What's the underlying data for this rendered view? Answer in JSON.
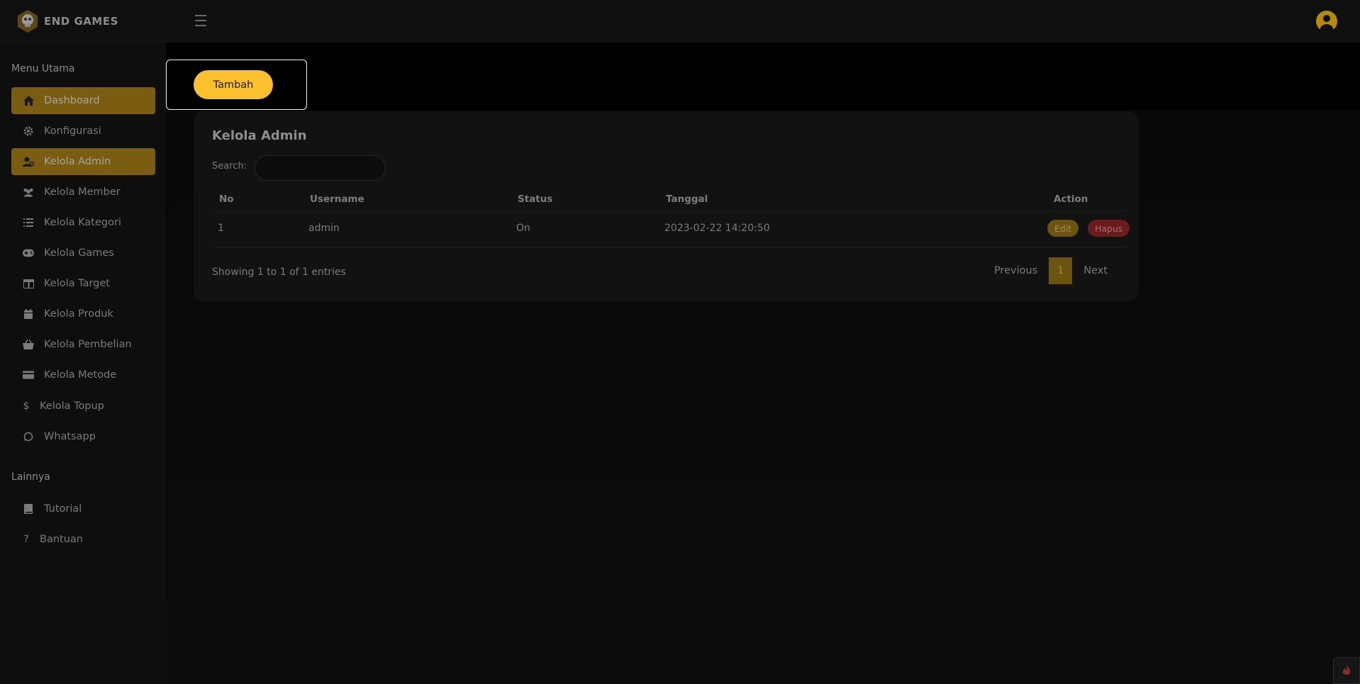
{
  "brand": {
    "name": "END GAMES"
  },
  "sidebar": {
    "section_main": "Menu Utama",
    "items": [
      {
        "label": "Dashboard",
        "icon": "home-icon",
        "active": true
      },
      {
        "label": "Konfigurasi",
        "icon": "gear-icon",
        "active": false
      },
      {
        "label": "Kelola Admin",
        "icon": "user-cog-icon",
        "active": true
      },
      {
        "label": "Kelola Member",
        "icon": "users-icon",
        "active": false
      },
      {
        "label": "Kelola Kategori",
        "icon": "list-icon",
        "active": false
      },
      {
        "label": "Kelola Games",
        "icon": "gamepad-icon",
        "active": false
      },
      {
        "label": "Kelola Target",
        "icon": "table-icon",
        "active": false
      },
      {
        "label": "Kelola Produk",
        "icon": "calendar-icon",
        "active": false
      },
      {
        "label": "Kelola Pembelian",
        "icon": "basket-icon",
        "active": false
      },
      {
        "label": "Kelola Metode",
        "icon": "credit-card-icon",
        "active": false
      },
      {
        "label": "Kelola Topup",
        "icon": "dollar-icon",
        "active": false
      },
      {
        "label": "Whatsapp",
        "icon": "whatsapp-icon",
        "active": false
      }
    ],
    "section_other": "Lainnya",
    "other_items": [
      {
        "label": "Tutorial",
        "icon": "book-icon"
      },
      {
        "label": "Bantuan",
        "icon": "question-icon"
      }
    ]
  },
  "main": {
    "add_button": "Tambah",
    "card_title": "Kelola Admin",
    "search_label": "Search:",
    "search_value": "",
    "columns": [
      "No",
      "Username",
      "Status",
      "Tanggal",
      "Action"
    ],
    "rows": [
      {
        "no": "1",
        "username": "admin",
        "status": "On",
        "tanggal": "2023-02-22 14:20:50"
      }
    ],
    "edit_label": "Edit",
    "delete_label": "Hapus",
    "info": "Showing 1 to 1 of 1 entries",
    "pager": {
      "prev": "Previous",
      "page": "1",
      "next": "Next"
    }
  },
  "colors": {
    "accent": "#fbc02d",
    "active_bg": "#7a5d11",
    "danger": "#6a1b1b"
  }
}
